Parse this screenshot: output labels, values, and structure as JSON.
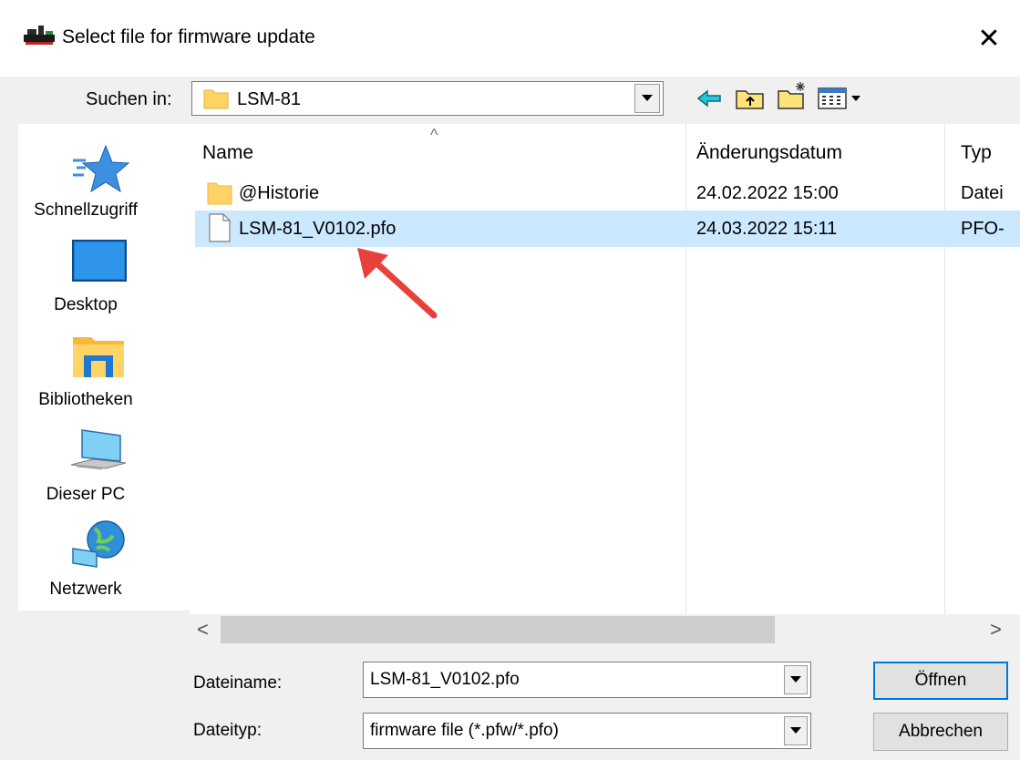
{
  "window": {
    "title": "Select file for firmware update",
    "close_label": "✕"
  },
  "lookin": {
    "label": "Suchen in:",
    "value": "LSM-81"
  },
  "toolbar": {
    "icons": [
      "back-icon",
      "up-folder-icon",
      "new-folder-icon",
      "view-menu-icon"
    ]
  },
  "sidebar": {
    "items": [
      {
        "label": "Schnellzugriff",
        "icon": "quick-access-star-icon"
      },
      {
        "label": "Desktop",
        "icon": "desktop-icon"
      },
      {
        "label": "Bibliotheken",
        "icon": "libraries-icon"
      },
      {
        "label": "Dieser PC",
        "icon": "computer-icon"
      },
      {
        "label": "Netzwerk",
        "icon": "network-icon"
      }
    ]
  },
  "filelist": {
    "columns": [
      "Name",
      "Änderungsdatum",
      "Typ"
    ],
    "sort_indicator": "^",
    "rows": [
      {
        "name": "@Historie",
        "date": "24.02.2022 15:00",
        "type": "Datei",
        "icon": "folder-icon",
        "selected": false
      },
      {
        "name": "LSM-81_V0102.pfo",
        "date": "24.03.2022 15:11",
        "type": "PFO-",
        "icon": "file-icon",
        "selected": true
      }
    ]
  },
  "scrollbar": {
    "left_arrow": "<",
    "right_arrow": ">"
  },
  "form": {
    "filename_label": "Dateiname:",
    "filename_value": "LSM-81_V0102.pfo",
    "filetype_label": "Dateityp:",
    "filetype_value": "firmware file (*.pfw/*.pfo)",
    "open_button": "Öffnen",
    "cancel_button": "Abbrechen"
  },
  "colors": {
    "selection": "#cce8ff",
    "annotation_arrow": "#e8403a",
    "folder": "#ffd464"
  }
}
